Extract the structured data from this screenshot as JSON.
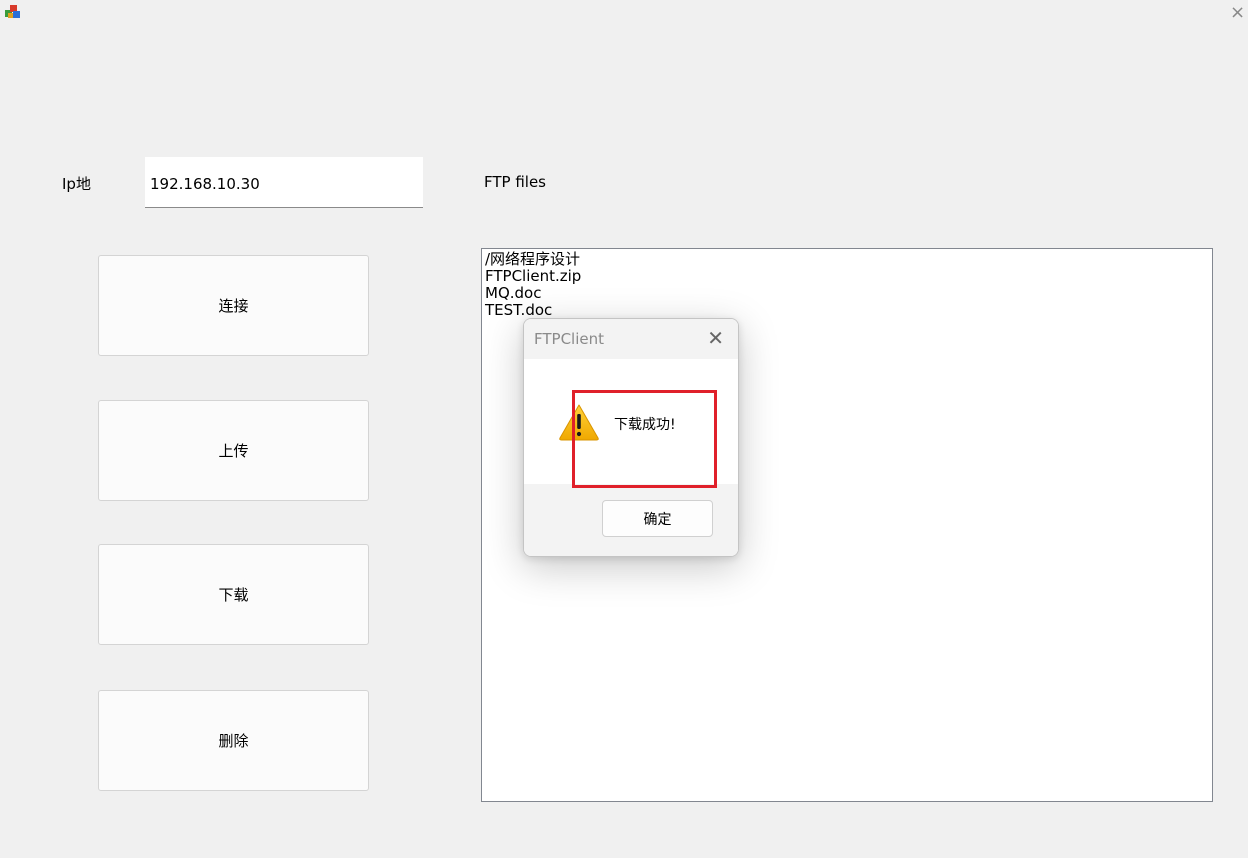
{
  "window": {
    "icon": "app-cubes-icon",
    "close_glyph": "×"
  },
  "form": {
    "ip_label": "Ip地",
    "ip_value": "192.168.10.30",
    "ftp_files_label": "FTP files"
  },
  "buttons": {
    "connect": "连接",
    "upload": "上传",
    "download": "下载",
    "delete": "删除"
  },
  "file_list": {
    "items": [
      "/网络程序设计",
      "FTPClient.zip",
      "MQ.doc",
      "TEST.doc"
    ]
  },
  "dialog": {
    "title": "FTPClient",
    "close_glyph": "✕",
    "icon": "warning-icon",
    "message": "下载成功!",
    "ok_label": "确定"
  },
  "colors": {
    "highlight": "#e0202a",
    "warning": "#f5b301"
  }
}
